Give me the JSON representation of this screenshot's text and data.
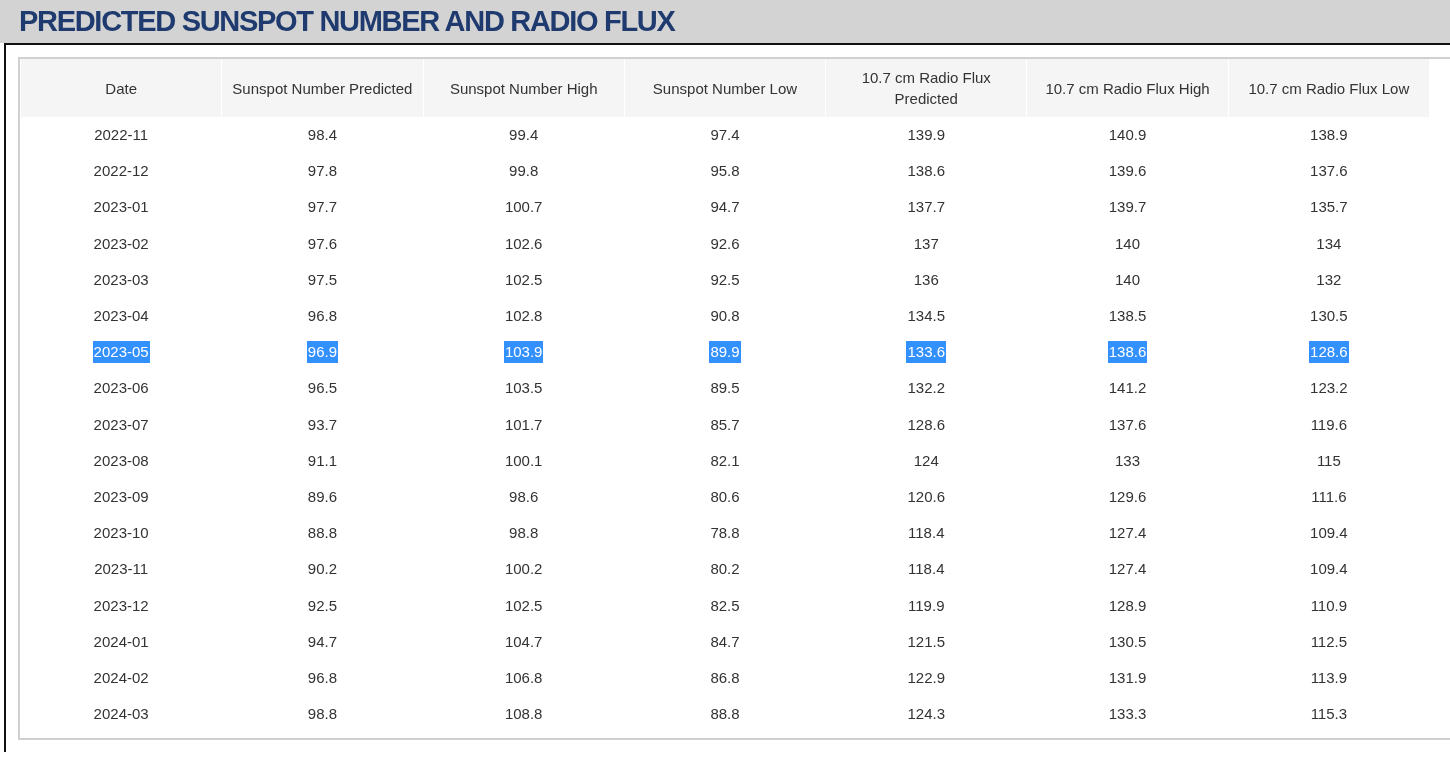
{
  "title": "PREDICTED SUNSPOT NUMBER AND RADIO FLUX",
  "table": {
    "columns": [
      "Date",
      "Sunspot Number Predicted",
      "Sunspot Number High",
      "Sunspot Number Low",
      "10.7 cm Radio Flux Predicted",
      "10.7 cm Radio Flux High",
      "10.7 cm Radio Flux Low"
    ],
    "rows": [
      {
        "cells": [
          "2022-11",
          "98.4",
          "99.4",
          "97.4",
          "139.9",
          "140.9",
          "138.9"
        ],
        "selected": false
      },
      {
        "cells": [
          "2022-12",
          "97.8",
          "99.8",
          "95.8",
          "138.6",
          "139.6",
          "137.6"
        ],
        "selected": false
      },
      {
        "cells": [
          "2023-01",
          "97.7",
          "100.7",
          "94.7",
          "137.7",
          "139.7",
          "135.7"
        ],
        "selected": false
      },
      {
        "cells": [
          "2023-02",
          "97.6",
          "102.6",
          "92.6",
          "137",
          "140",
          "134"
        ],
        "selected": false
      },
      {
        "cells": [
          "2023-03",
          "97.5",
          "102.5",
          "92.5",
          "136",
          "140",
          "132"
        ],
        "selected": false
      },
      {
        "cells": [
          "2023-04",
          "96.8",
          "102.8",
          "90.8",
          "134.5",
          "138.5",
          "130.5"
        ],
        "selected": false
      },
      {
        "cells": [
          "2023-05",
          "96.9",
          "103.9",
          "89.9",
          "133.6",
          "138.6",
          "128.6"
        ],
        "selected": true
      },
      {
        "cells": [
          "2023-06",
          "96.5",
          "103.5",
          "89.5",
          "132.2",
          "141.2",
          "123.2"
        ],
        "selected": false
      },
      {
        "cells": [
          "2023-07",
          "93.7",
          "101.7",
          "85.7",
          "128.6",
          "137.6",
          "119.6"
        ],
        "selected": false
      },
      {
        "cells": [
          "2023-08",
          "91.1",
          "100.1",
          "82.1",
          "124",
          "133",
          "115"
        ],
        "selected": false
      },
      {
        "cells": [
          "2023-09",
          "89.6",
          "98.6",
          "80.6",
          "120.6",
          "129.6",
          "111.6"
        ],
        "selected": false
      },
      {
        "cells": [
          "2023-10",
          "88.8",
          "98.8",
          "78.8",
          "118.4",
          "127.4",
          "109.4"
        ],
        "selected": false
      },
      {
        "cells": [
          "2023-11",
          "90.2",
          "100.2",
          "80.2",
          "118.4",
          "127.4",
          "109.4"
        ],
        "selected": false
      },
      {
        "cells": [
          "2023-12",
          "92.5",
          "102.5",
          "82.5",
          "119.9",
          "128.9",
          "110.9"
        ],
        "selected": false
      },
      {
        "cells": [
          "2024-01",
          "94.7",
          "104.7",
          "84.7",
          "121.5",
          "130.5",
          "112.5"
        ],
        "selected": false
      },
      {
        "cells": [
          "2024-02",
          "96.8",
          "106.8",
          "86.8",
          "122.9",
          "131.9",
          "113.9"
        ],
        "selected": false
      },
      {
        "cells": [
          "2024-03",
          "98.8",
          "108.8",
          "88.8",
          "124.3",
          "133.3",
          "115.3"
        ],
        "selected": false
      }
    ]
  }
}
